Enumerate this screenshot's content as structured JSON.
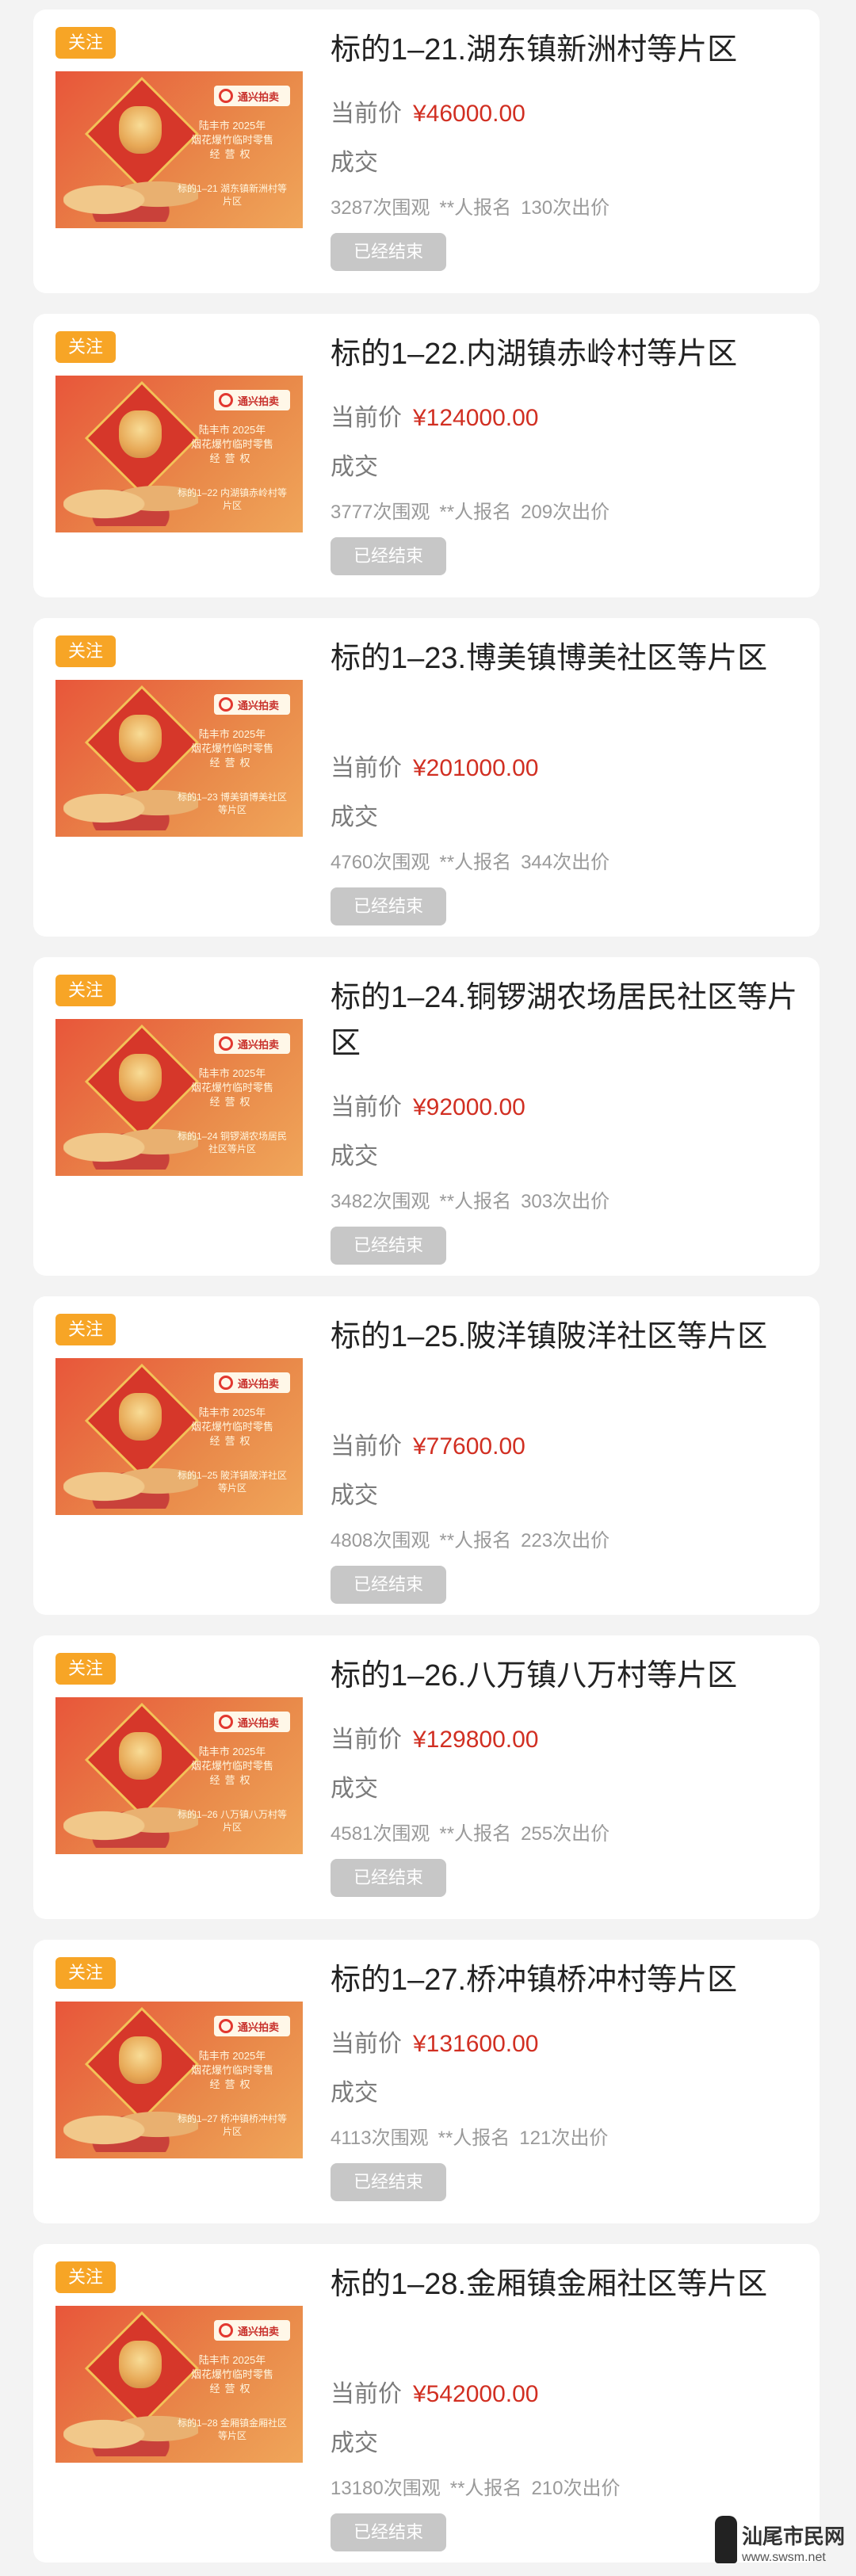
{
  "items": [
    {
      "follow": "关注",
      "title": "标的1–21.湖东镇新洲村等片区",
      "price_label": "当前价",
      "price": "¥46000.00",
      "deal": "成交",
      "views": "3287次围观",
      "signup": "**人报名",
      "bids": "130次出价",
      "status": "已经结束",
      "thumb": {
        "logo": "通兴拍卖",
        "line1": "陆丰市 2025年",
        "line2": "烟花爆竹临时零售",
        "line3": "经营权",
        "line4": "标的1–21 湖东镇新洲村等片区"
      }
    },
    {
      "follow": "关注",
      "title": "标的1–22.内湖镇赤岭村等片区",
      "price_label": "当前价",
      "price": "¥124000.00",
      "deal": "成交",
      "views": "3777次围观",
      "signup": "**人报名",
      "bids": "209次出价",
      "status": "已经结束",
      "thumb": {
        "logo": "通兴拍卖",
        "line1": "陆丰市 2025年",
        "line2": "烟花爆竹临时零售",
        "line3": "经营权",
        "line4": "标的1–22 内湖镇赤岭村等片区"
      }
    },
    {
      "follow": "关注",
      "title": "标的1–23.博美镇博美社区等片区",
      "price_label": "当前价",
      "price": "¥201000.00",
      "deal": "成交",
      "views": "4760次围观",
      "signup": "**人报名",
      "bids": "344次出价",
      "status": "已经结束",
      "thumb": {
        "logo": "通兴拍卖",
        "line1": "陆丰市 2025年",
        "line2": "烟花爆竹临时零售",
        "line3": "经营权",
        "line4": "标的1–23 博美镇博美社区等片区"
      }
    },
    {
      "follow": "关注",
      "title": "标的1–24.铜锣湖农场居民社区等片区",
      "price_label": "当前价",
      "price": "¥92000.00",
      "deal": "成交",
      "views": "3482次围观",
      "signup": "**人报名",
      "bids": "303次出价",
      "status": "已经结束",
      "thumb": {
        "logo": "通兴拍卖",
        "line1": "陆丰市 2025年",
        "line2": "烟花爆竹临时零售",
        "line3": "经营权",
        "line4": "标的1–24 铜锣湖农场居民社区等片区"
      }
    },
    {
      "follow": "关注",
      "title": "标的1–25.陂洋镇陂洋社区等片区",
      "price_label": "当前价",
      "price": "¥77600.00",
      "deal": "成交",
      "views": "4808次围观",
      "signup": "**人报名",
      "bids": "223次出价",
      "status": "已经结束",
      "thumb": {
        "logo": "通兴拍卖",
        "line1": "陆丰市 2025年",
        "line2": "烟花爆竹临时零售",
        "line3": "经营权",
        "line4": "标的1–25 陂洋镇陂洋社区等片区"
      }
    },
    {
      "follow": "关注",
      "title": "标的1–26.八万镇八万村等片区",
      "price_label": "当前价",
      "price": "¥129800.00",
      "deal": "成交",
      "views": "4581次围观",
      "signup": "**人报名",
      "bids": "255次出价",
      "status": "已经结束",
      "thumb": {
        "logo": "通兴拍卖",
        "line1": "陆丰市 2025年",
        "line2": "烟花爆竹临时零售",
        "line3": "经营权",
        "line4": "标的1–26 八万镇八万村等片区"
      }
    },
    {
      "follow": "关注",
      "title": "标的1–27.桥冲镇桥冲村等片区",
      "price_label": "当前价",
      "price": "¥131600.00",
      "deal": "成交",
      "views": "4113次围观",
      "signup": "**人报名",
      "bids": "121次出价",
      "status": "已经结束",
      "thumb": {
        "logo": "通兴拍卖",
        "line1": "陆丰市 2025年",
        "line2": "烟花爆竹临时零售",
        "line3": "经营权",
        "line4": "标的1–27 桥冲镇桥冲村等片区"
      }
    },
    {
      "follow": "关注",
      "title": "标的1–28.金厢镇金厢社区等片区",
      "price_label": "当前价",
      "price": "¥542000.00",
      "deal": "成交",
      "views": "13180次围观",
      "signup": "**人报名",
      "bids": "210次出价",
      "status": "已经结束",
      "thumb": {
        "logo": "通兴拍卖",
        "line1": "陆丰市 2025年",
        "line2": "烟花爆竹临时零售",
        "line3": "经营权",
        "line4": "标的1–28 金厢镇金厢社区等片区"
      }
    }
  ],
  "watermark": {
    "text": "汕尾市民网",
    "url": "www.swsm.net"
  }
}
